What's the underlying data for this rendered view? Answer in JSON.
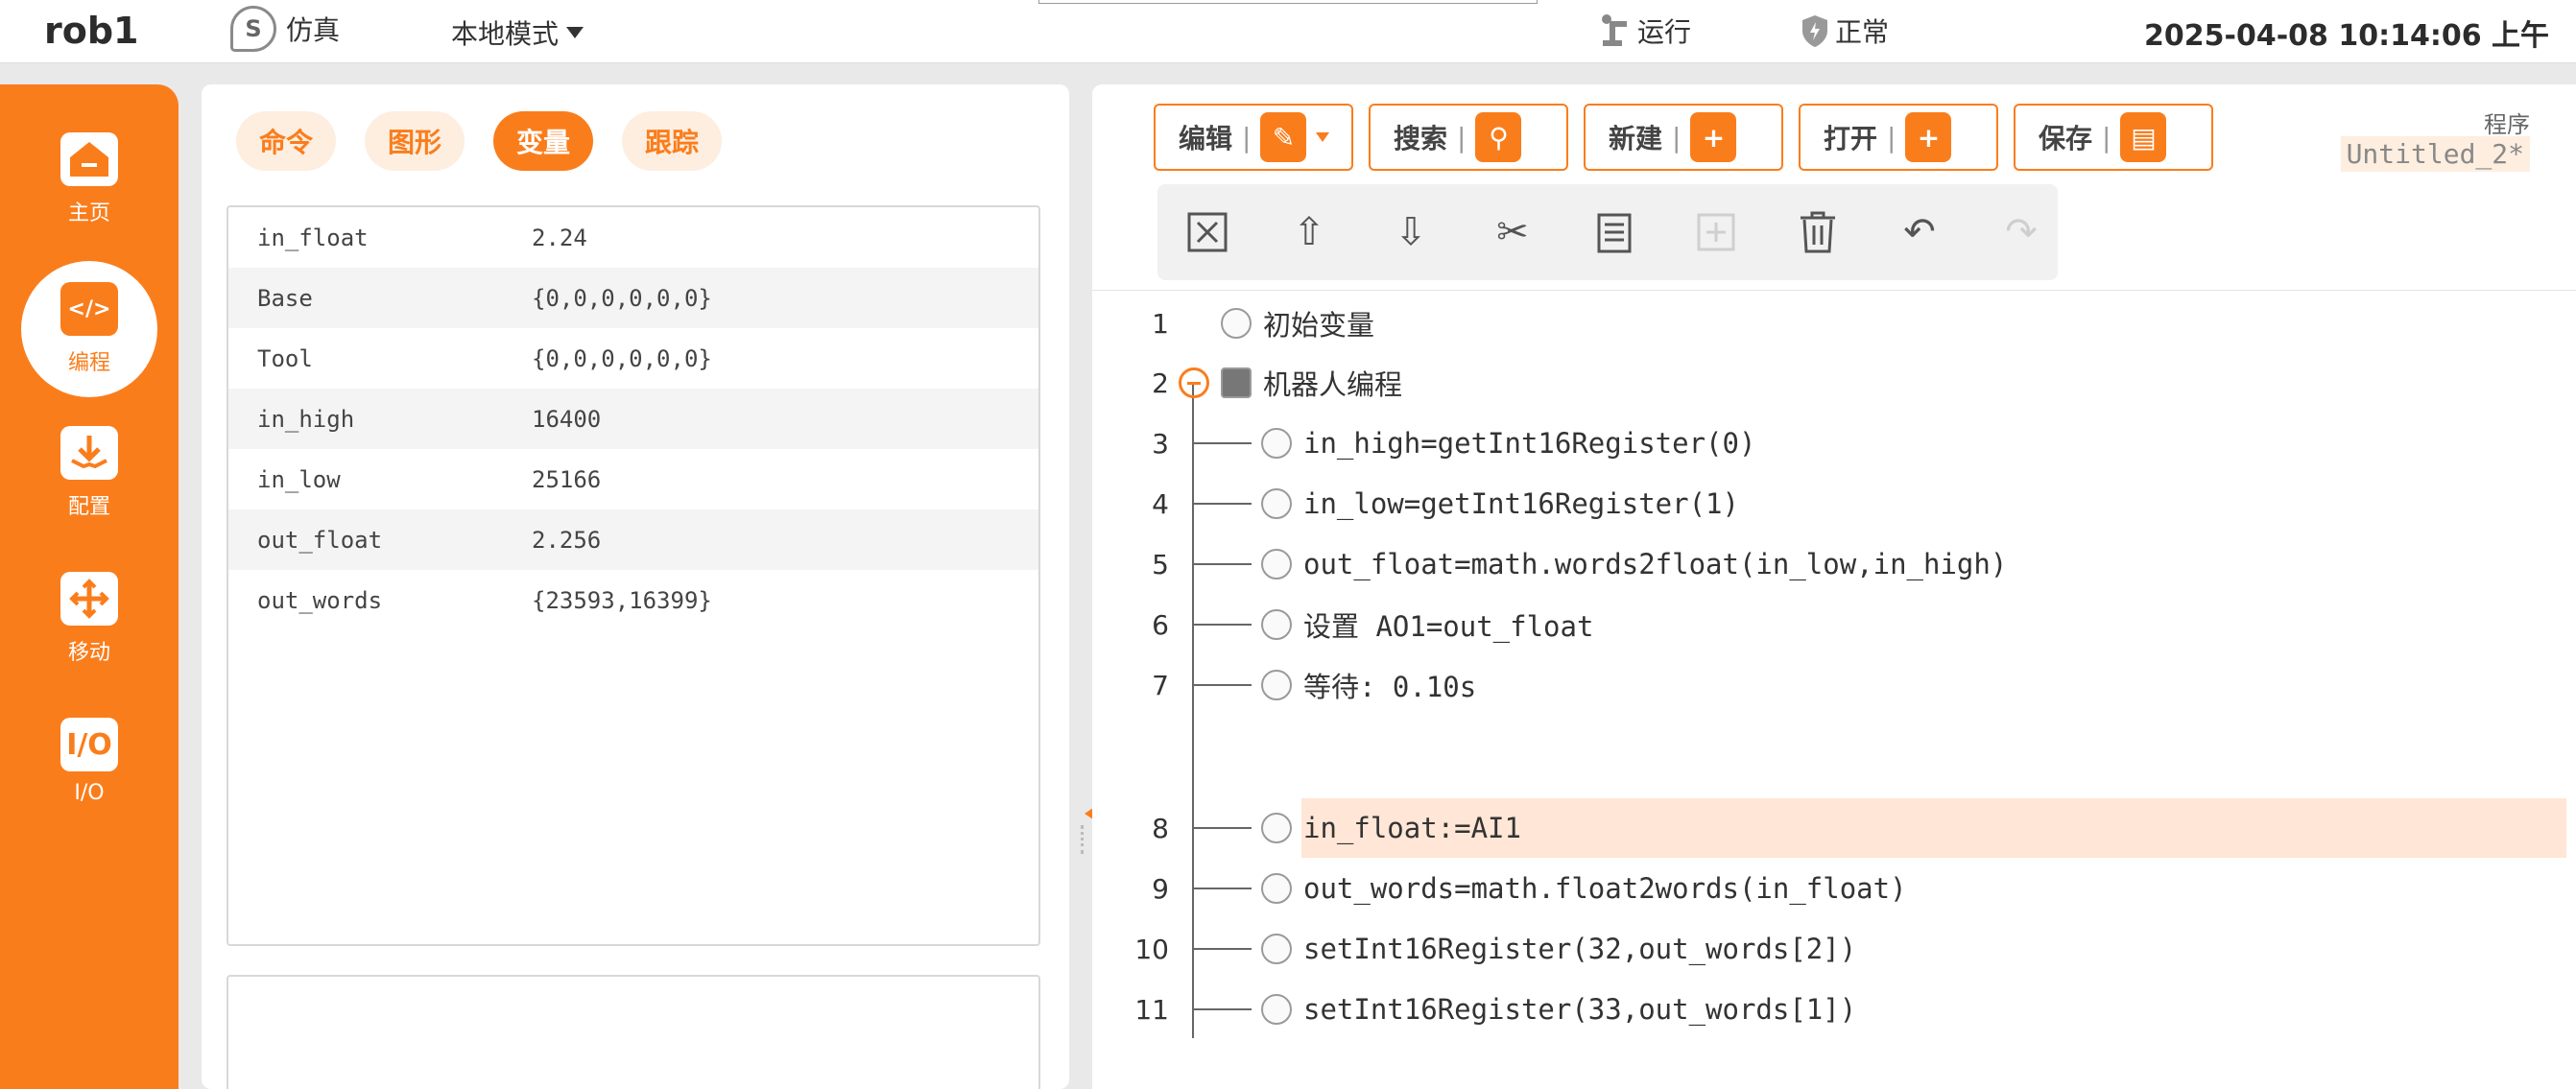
{
  "topbar": {
    "title": "rob1",
    "sim_icon": "S",
    "sim_label": "仿真",
    "mode_label": "本地模式",
    "run_label": "运行",
    "status_label": "正常",
    "datetime": "2025-04-08 10:14:06 上午"
  },
  "sidebar": {
    "items": [
      {
        "label": "主页",
        "icon": "home-icon"
      },
      {
        "label": "编程",
        "icon": "code-icon",
        "glyph": "</>"
      },
      {
        "label": "配置",
        "icon": "download-icon"
      },
      {
        "label": "移动",
        "icon": "move-icon"
      },
      {
        "label": "I/O",
        "icon": "io-icon",
        "glyph": "I/O"
      }
    ]
  },
  "left": {
    "tabs": [
      "命令",
      "图形",
      "变量",
      "跟踪"
    ],
    "active_tab": "变量",
    "variables": [
      {
        "name": "in_float",
        "value": "2.24"
      },
      {
        "name": "Base",
        "value": "{0,0,0,0,0,0}"
      },
      {
        "name": "Tool",
        "value": "{0,0,0,0,0,0}"
      },
      {
        "name": "in_high",
        "value": "16400"
      },
      {
        "name": "in_low",
        "value": "25166"
      },
      {
        "name": "out_float",
        "value": "2.256"
      },
      {
        "name": "out_words",
        "value": "{23593,16399}"
      }
    ]
  },
  "right": {
    "toolbar": {
      "edit": "编辑",
      "search": "搜索",
      "new": "新建",
      "open": "打开",
      "save": "保存"
    },
    "program_label": "程序",
    "program_name": "Untitled_2*",
    "lines": [
      {
        "num": "1",
        "text": "初始变量"
      },
      {
        "num": "2",
        "text": "机器人编程"
      },
      {
        "num": "3",
        "text": "in_high=getInt16Register(0)"
      },
      {
        "num": "4",
        "text": "in_low=getInt16Register(1)"
      },
      {
        "num": "5",
        "text": "out_float=math.words2float(in_low,in_high)"
      },
      {
        "num": "6",
        "text": "设置 AO1=out_float"
      },
      {
        "num": "7",
        "text": "等待: 0.10s"
      },
      {
        "num": "8",
        "text": "in_float:=AI1"
      },
      {
        "num": "9",
        "text": "out_words=math.float2words(in_float)"
      },
      {
        "num": "10",
        "text": "setInt16Register(32,out_words[2])"
      },
      {
        "num": "11",
        "text": "setInt16Register(33,out_words[1])"
      }
    ],
    "highlighted_line": "8"
  },
  "colors": {
    "accent": "#fa7d1c",
    "highlight": "#ffe6d6"
  }
}
